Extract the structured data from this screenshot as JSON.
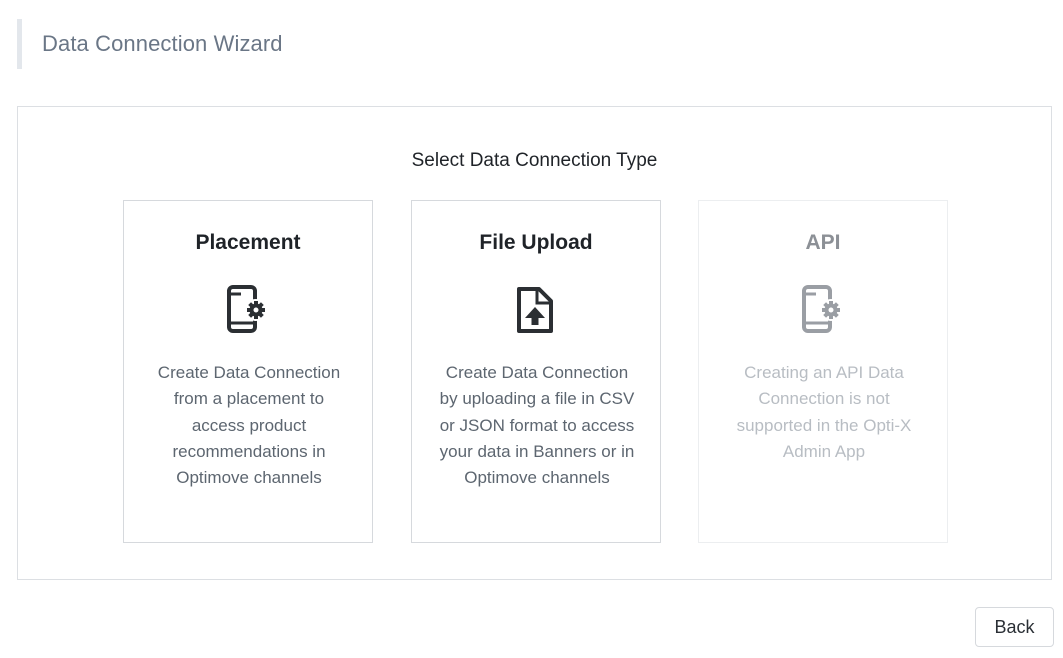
{
  "page": {
    "title": "Data Connection Wizard"
  },
  "wizard": {
    "heading": "Select Data Connection Type",
    "options": [
      {
        "title": "Placement",
        "icon": "mobile-settings-icon",
        "description": "Create Data Connection from a placement to access product recommendations in Optimove channels",
        "enabled": true
      },
      {
        "title": "File Upload",
        "icon": "file-upload-icon",
        "description": "Create Data Connection by uploading a file in CSV or JSON format to access your data in Banners or in Optimove channels",
        "enabled": true
      },
      {
        "title": "API",
        "icon": "mobile-settings-icon",
        "description": "Creating an API Data Connection is not supported in the Opti-X Admin App",
        "enabled": false
      }
    ]
  },
  "footer": {
    "back_label": "Back"
  },
  "colors": {
    "icon_enabled": "#2b2f33",
    "icon_disabled": "#9a9ea4",
    "header_accent": "#e3e7ec"
  }
}
